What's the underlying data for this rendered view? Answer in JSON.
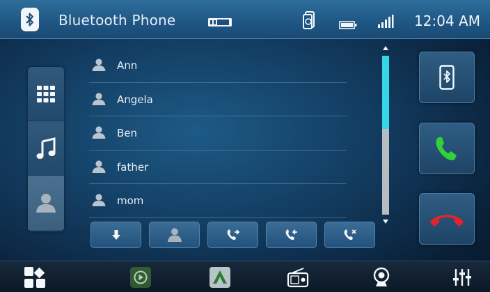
{
  "status_bar": {
    "title": "Bluetooth Phone",
    "time": "12:04 AM",
    "icons": [
      "bluetooth-icon",
      "sd-card-icon",
      "phone-sync-icon",
      "battery-icon",
      "signal-icon"
    ]
  },
  "side_tabs": [
    {
      "name": "keypad",
      "icon": "keypad-icon"
    },
    {
      "name": "music",
      "icon": "music-note-icon"
    },
    {
      "name": "contacts",
      "icon": "person-icon"
    }
  ],
  "contacts": [
    {
      "name": "Ann"
    },
    {
      "name": "Angela"
    },
    {
      "name": "Ben"
    },
    {
      "name": "father"
    },
    {
      "name": "mom"
    }
  ],
  "scroll": {
    "thumb_fraction_start": 0.0,
    "thumb_fraction_size": 0.46
  },
  "action_buttons": [
    "download-icon",
    "person-icon",
    "outgoing-calls-icon",
    "incoming-calls-icon",
    "missed-calls-icon"
  ],
  "right_buttons": [
    "phone-bluetooth-icon",
    "call-answer-icon",
    "call-hangup-icon"
  ],
  "dock": [
    "apps-icon",
    "carplay-icon",
    "android-auto-icon",
    "radio-icon",
    "camera-icon",
    "equalizer-icon"
  ],
  "colors": {
    "accent": "#35d6e6",
    "answer": "#2fd23a",
    "hangup": "#e8222a"
  }
}
